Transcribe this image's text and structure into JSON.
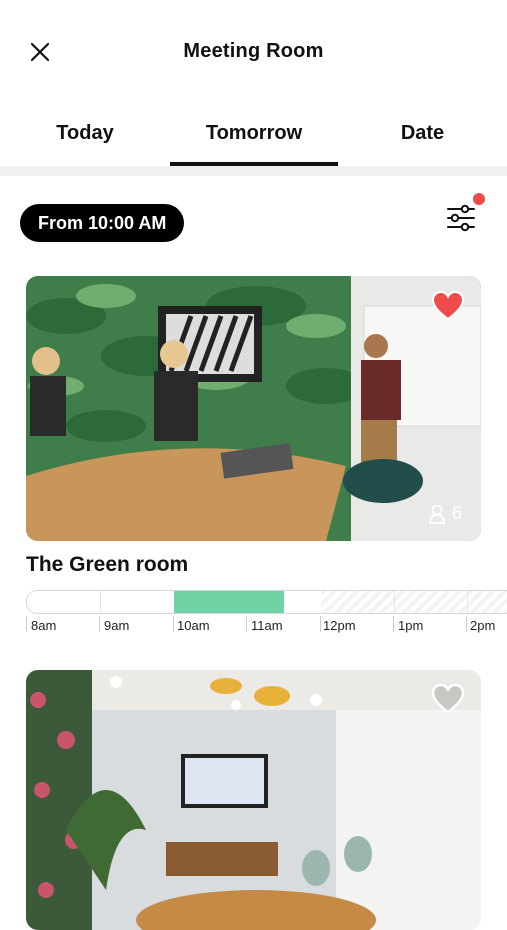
{
  "header": {
    "title": "Meeting Room",
    "close_icon": "close-icon"
  },
  "tabs": [
    {
      "label": "Today",
      "active": false
    },
    {
      "label": "Tomorrow",
      "active": true
    },
    {
      "label": "Date",
      "active": false
    }
  ],
  "filters": {
    "from_label": "From 10:00 AM",
    "filter_icon": "sliders-icon",
    "has_active_filter": true,
    "dot_color": "#ef4b4b"
  },
  "rooms": [
    {
      "name": "The Green room",
      "capacity": "6",
      "favorite": true,
      "availability": {
        "hours": [
          "8am",
          "9am",
          "10am",
          "11am",
          "12pm",
          "1pm",
          "2pm"
        ],
        "booked": {
          "start": "10am",
          "end": "11:30am",
          "color": "#6fd3a6"
        },
        "unavailable_from": "12pm"
      }
    },
    {
      "name": "",
      "favorite": false
    }
  ],
  "colors": {
    "accent": "#000000",
    "heart_active": "#ef4b4b",
    "booked": "#6fd3a6"
  }
}
